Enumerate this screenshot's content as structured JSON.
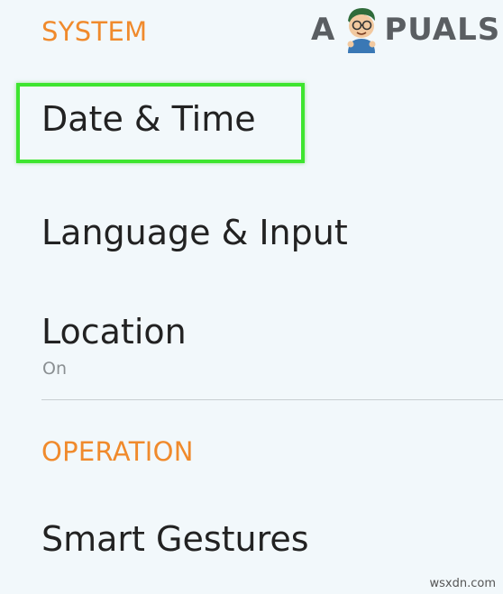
{
  "sections": {
    "system": {
      "label": "SYSTEM"
    },
    "operation": {
      "label": "OPERATION"
    }
  },
  "items": {
    "date_time": {
      "title": "Date & Time"
    },
    "language_input": {
      "title": "Language & Input"
    },
    "location": {
      "title": "Location",
      "subtitle": "On"
    },
    "smart_gestures": {
      "title": "Smart Gestures"
    }
  },
  "logo": {
    "letter_a": "A",
    "rest": "PUALS",
    "mascot_icon": "appuals-mascot-icon"
  },
  "watermark": {
    "text": "wsxdn.com"
  },
  "colors": {
    "section_header": "#f08a2c",
    "highlight_border": "#3ee52f",
    "background": "#f2f8fb"
  }
}
